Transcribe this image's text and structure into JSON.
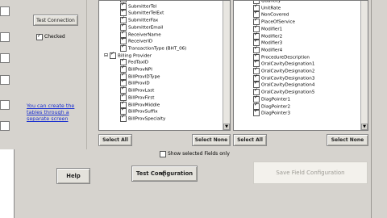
{
  "left": {
    "test_connection": "Test Connection",
    "checked_label": "Checked",
    "link_text": "You can create the tables through a separate screen",
    "help": "Help"
  },
  "fields_left": {
    "rows": [
      {
        "label": "SubmitterContact",
        "indent": 1,
        "checked": true
      },
      {
        "label": "SubmitterTel",
        "indent": 1,
        "checked": true
      },
      {
        "label": "SubmitterTelExt",
        "indent": 1,
        "checked": true
      },
      {
        "label": "SubmitterFax",
        "indent": 1,
        "checked": true
      },
      {
        "label": "SubmitterEmail",
        "indent": 1,
        "checked": true
      },
      {
        "label": "ReceiverName",
        "indent": 1,
        "checked": true
      },
      {
        "label": "ReceiverID",
        "indent": 1,
        "checked": true
      },
      {
        "label": "TransactionType (BHT_06)",
        "indent": 1,
        "checked": true
      },
      {
        "label": "Billing Provider",
        "indent": 0,
        "checked": true,
        "group": true
      },
      {
        "label": "FedTaxID",
        "indent": 1,
        "checked": true
      },
      {
        "label": "BillProvNPI",
        "indent": 1,
        "checked": true
      },
      {
        "label": "BillProvIDType",
        "indent": 1,
        "checked": true
      },
      {
        "label": "BillProvID",
        "indent": 1,
        "checked": true
      },
      {
        "label": "BillProvLast",
        "indent": 1,
        "checked": true
      },
      {
        "label": "BillProvFirst",
        "indent": 1,
        "checked": true
      },
      {
        "label": "BillProvMiddle",
        "indent": 1,
        "checked": true
      },
      {
        "label": "BillProvSuffix",
        "indent": 1,
        "checked": true
      },
      {
        "label": "BillProvSpecialty",
        "indent": 1,
        "checked": true
      }
    ]
  },
  "fields_right": {
    "rows": [
      {
        "label": "Quantity",
        "checked": true
      },
      {
        "label": "UnitRate",
        "checked": true
      },
      {
        "label": "NonCovered",
        "checked": true
      },
      {
        "label": "PlaceOfService",
        "checked": true
      },
      {
        "label": "Modifier1",
        "checked": true
      },
      {
        "label": "Modifier2",
        "checked": true
      },
      {
        "label": "Modifier3",
        "checked": true
      },
      {
        "label": "Modifier4",
        "checked": true
      },
      {
        "label": "ProcedureDescription",
        "checked": true
      },
      {
        "label": "OralCavityDesignation1",
        "checked": true
      },
      {
        "label": "OralCavityDesignation2",
        "checked": true
      },
      {
        "label": "OralCavityDesignation3",
        "checked": true
      },
      {
        "label": "OralCavityDesignation4",
        "checked": true
      },
      {
        "label": "OralCavityDesignation5",
        "checked": true
      },
      {
        "label": "DiagPointer1",
        "checked": true
      },
      {
        "label": "DiagPointer2",
        "checked": true
      },
      {
        "label": "DiagPointer3",
        "checked": true
      }
    ]
  },
  "buttons": {
    "select_all": "Select All",
    "select_none": "Select None",
    "show_selected": "Show selected Fields only",
    "test_configuration": "Test Configuration",
    "save_field_configuration": "Save Field Configuration"
  }
}
